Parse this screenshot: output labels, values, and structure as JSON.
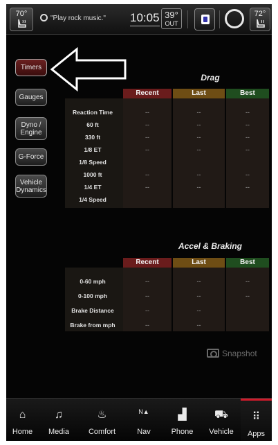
{
  "status_bar": {
    "driver_temp": "70°",
    "passenger_temp": "72°",
    "voice_hint": "\"Play rock music.\"",
    "clock": "10:05",
    "outside_temp": "39°",
    "outside_label": "OUT"
  },
  "side_tabs": [
    {
      "label": "Timers",
      "active": true
    },
    {
      "label": "Gauges"
    },
    {
      "label": "Dyno / Engine"
    },
    {
      "label": "G-Force"
    },
    {
      "label": "Vehicle Dynamics"
    }
  ],
  "drag": {
    "title": "Drag",
    "columns": [
      "Recent",
      "Last",
      "Best"
    ],
    "rows": [
      {
        "label": "Reaction Time",
        "recent": "--",
        "last": "--",
        "best": "--"
      },
      {
        "label": "60 ft",
        "recent": "--",
        "last": "--",
        "best": "--"
      },
      {
        "label": "330 ft",
        "recent": "--",
        "last": "--",
        "best": "--"
      },
      {
        "label": "1/8 ET",
        "recent": "--",
        "last": "--",
        "best": "--"
      },
      {
        "label": "1/8 Speed",
        "recent": "",
        "last": "",
        "best": ""
      },
      {
        "label": "1000 ft",
        "recent": "--",
        "last": "--",
        "best": "--"
      },
      {
        "label": "1/4 ET",
        "recent": "--",
        "last": "--",
        "best": "--"
      },
      {
        "label": "1/4 Speed",
        "recent": "",
        "last": "",
        "best": ""
      }
    ]
  },
  "accel": {
    "title": "Accel & Braking",
    "columns": [
      "Recent",
      "Last",
      "Best"
    ],
    "rows": [
      {
        "label": "0-60 mph",
        "recent": "--",
        "last": "--",
        "best": "--"
      },
      {
        "label": "0-100 mph",
        "recent": "--",
        "last": "--",
        "best": "--"
      },
      {
        "label": "Brake Distance",
        "recent": "--",
        "last": "--",
        "best": ""
      },
      {
        "label": "Brake from mph",
        "recent": "--",
        "last": "--",
        "best": ""
      }
    ]
  },
  "snapshot_label": "Snapshot",
  "nav": [
    {
      "label": "Home",
      "icon": "home-icon",
      "glyph": "⌂"
    },
    {
      "label": "Media",
      "icon": "music-note-icon",
      "glyph": "♫"
    },
    {
      "label": "Comfort",
      "icon": "seat-icon",
      "glyph": "♨"
    },
    {
      "label": "Nav",
      "icon": "compass-north-icon",
      "glyph": "N▲"
    },
    {
      "label": "Phone",
      "icon": "signal-bars-icon",
      "glyph": "▟"
    },
    {
      "label": "Vehicle",
      "icon": "car-icon",
      "glyph": "⛟"
    },
    {
      "label": "Apps",
      "icon": "apps-grid-icon",
      "glyph": "⠿",
      "active": true
    }
  ],
  "colors": {
    "recent": "#6a1c1c",
    "last": "#6e4d14",
    "best": "#1f4d1f",
    "accent": "#d21a2a"
  }
}
